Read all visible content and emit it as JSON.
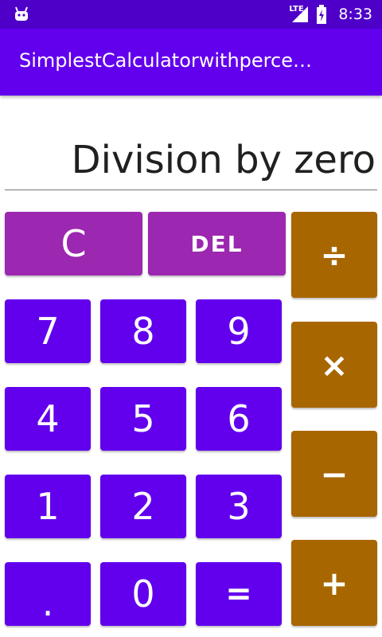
{
  "status_bar": {
    "network_label": "LTE",
    "time": "8:33",
    "icons": [
      "android-icon",
      "signal-icon",
      "battery-icon"
    ]
  },
  "app_bar": {
    "title": "SimplestCalculatorwithperce…"
  },
  "display": {
    "value": "Division by zero"
  },
  "buttons": {
    "clear": "C",
    "delete": "DEL",
    "divide": "÷",
    "multiply": "×",
    "minus": "−",
    "plus": "+",
    "seven": "7",
    "eight": "8",
    "nine": "9",
    "four": "4",
    "five": "5",
    "six": "6",
    "one": "1",
    "two": "2",
    "three": "3",
    "dot": ".",
    "zero": "0",
    "equals": "="
  },
  "colors": {
    "status_bar": "#4e00c9",
    "app_bar": "#6200ee",
    "number_button": "#6200ee",
    "function_button": "#9c27b0",
    "operator_button": "#a86600"
  }
}
